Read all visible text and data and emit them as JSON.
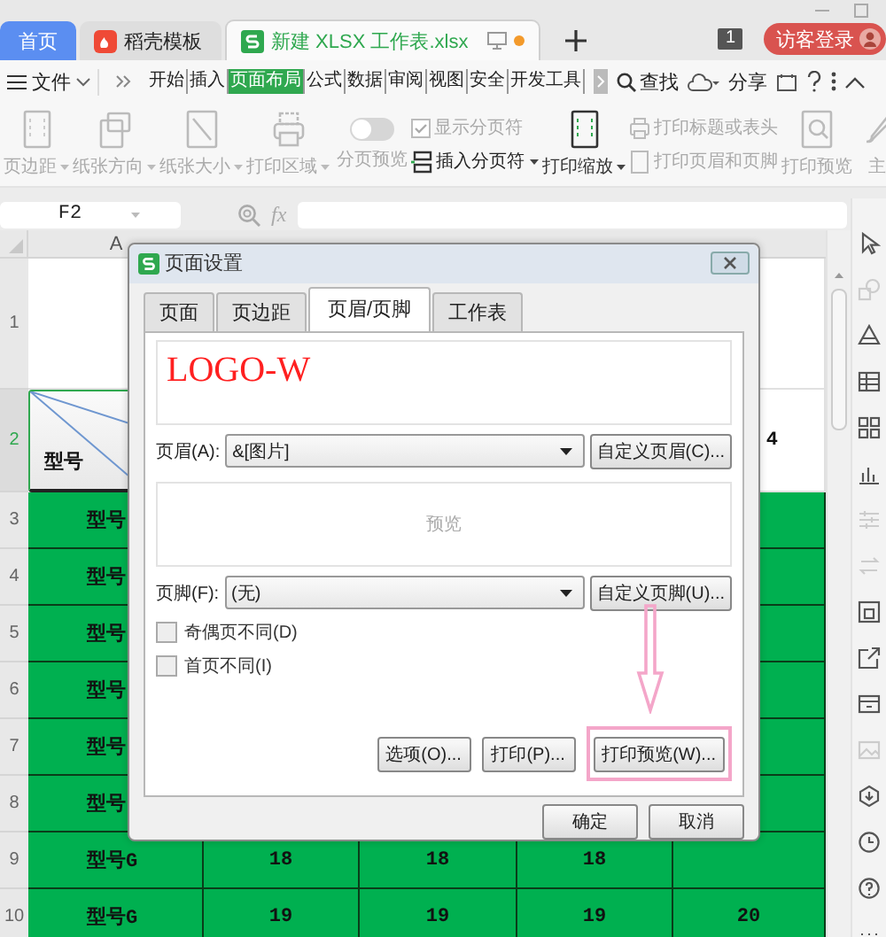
{
  "title_bar": {
    "tabs": [
      {
        "label": "首页",
        "kind": "home",
        "selected": false
      },
      {
        "label": "稻壳模板",
        "kind": "docer",
        "selected": false
      },
      {
        "label": "新建 XLSX 工作表.xlsx",
        "kind": "sheet",
        "selected": true
      }
    ],
    "badge": "1",
    "login": "访客登录"
  },
  "menu": {
    "file": "文件",
    "tabs": [
      {
        "label": "开始",
        "selected": false
      },
      {
        "label": "插入",
        "selected": false
      },
      {
        "label": "页面布局",
        "selected": true
      },
      {
        "label": "公式",
        "selected": false
      },
      {
        "label": "数据",
        "selected": false
      },
      {
        "label": "审阅",
        "selected": false
      },
      {
        "label": "视图",
        "selected": false
      },
      {
        "label": "安全",
        "selected": false
      },
      {
        "label": "开发工具",
        "selected": false
      }
    ],
    "search": "查找",
    "share": "分享"
  },
  "ribbon": [
    {
      "kind": "large",
      "label": "页边距",
      "dropdown": true,
      "disabled": true
    },
    {
      "kind": "large",
      "label": "纸张方向",
      "dropdown": true,
      "disabled": true
    },
    {
      "kind": "large",
      "label": "纸张大小",
      "dropdown": true,
      "disabled": true
    },
    {
      "kind": "large",
      "label": "打印区域",
      "dropdown": true,
      "disabled": true
    },
    {
      "kind": "toggle",
      "label": "分页预览",
      "on": false,
      "disabled": true
    },
    {
      "kind": "stack",
      "items": [
        {
          "kind": "check",
          "label": "显示分页符",
          "checked": true,
          "disabled": true
        },
        {
          "kind": "small",
          "label": "插入分页符",
          "dropdown": true,
          "disabled": false
        }
      ]
    },
    {
      "kind": "large",
      "label": "打印缩放",
      "dropdown": true,
      "disabled": false
    },
    {
      "kind": "stack",
      "items": [
        {
          "kind": "small",
          "label": "打印标题或表头",
          "dropdown": false,
          "disabled": true
        },
        {
          "kind": "small",
          "label": "打印页眉和页脚",
          "dropdown": false,
          "disabled": true
        }
      ]
    },
    {
      "kind": "large",
      "label": "打印预览",
      "dropdown": false,
      "disabled": true
    },
    {
      "kind": "large",
      "label": "主",
      "dropdown": false,
      "disabled": true
    }
  ],
  "formula_bar": {
    "cell": "F2",
    "fx": "fx"
  },
  "sheet": {
    "column_header": "A",
    "rows": [
      {
        "header": "1",
        "highlighted": false,
        "diagonal": false,
        "cells": []
      },
      {
        "header": "2",
        "highlighted": false,
        "diagonal": true,
        "cells": [
          "型号",
          null,
          null,
          null,
          "4"
        ]
      },
      {
        "header": "3",
        "highlighted": true,
        "diagonal": false,
        "cells": [
          "型号"
        ]
      },
      {
        "header": "4",
        "highlighted": true,
        "diagonal": false,
        "cells": [
          "型号"
        ]
      },
      {
        "header": "5",
        "highlighted": true,
        "diagonal": false,
        "cells": [
          "型号"
        ]
      },
      {
        "header": "6",
        "highlighted": true,
        "diagonal": false,
        "cells": [
          "型号"
        ]
      },
      {
        "header": "7",
        "highlighted": true,
        "diagonal": false,
        "cells": [
          "型号"
        ]
      },
      {
        "header": "8",
        "highlighted": true,
        "diagonal": false,
        "cells": [
          "型号"
        ]
      },
      {
        "header": "9",
        "highlighted": true,
        "diagonal": false,
        "cells": [
          "型号G",
          "18",
          "18",
          "18"
        ]
      },
      {
        "header": "10",
        "highlighted": true,
        "diagonal": false,
        "cells": [
          "型号G",
          "19",
          "19",
          "19",
          "20"
        ]
      }
    ]
  },
  "dialog": {
    "title": "页面设置",
    "tabs": [
      {
        "label": "页面",
        "selected": false
      },
      {
        "label": "页边距",
        "selected": false
      },
      {
        "label": "页眉/页脚",
        "selected": true
      },
      {
        "label": "工作表",
        "selected": false
      }
    ],
    "header_preview": "LOGO-W",
    "header_label": "页眉(A):",
    "header_value": "&[图片]",
    "custom_header": "自定义页眉(C)...",
    "footer_preview": "预览",
    "footer_label": "页脚(F):",
    "footer_value": "(无)",
    "custom_footer": "自定义页脚(U)...",
    "checkboxes": [
      {
        "label": "奇偶页不同(D)",
        "checked": false
      },
      {
        "label": "首页不同(I)",
        "checked": false
      }
    ],
    "actions": [
      {
        "label": "选项(O)...",
        "highlighted": false
      },
      {
        "label": "打印(P)...",
        "highlighted": false
      },
      {
        "label": "打印预览(W)...",
        "highlighted": true
      }
    ],
    "buttons": [
      "确定",
      "取消"
    ]
  }
}
